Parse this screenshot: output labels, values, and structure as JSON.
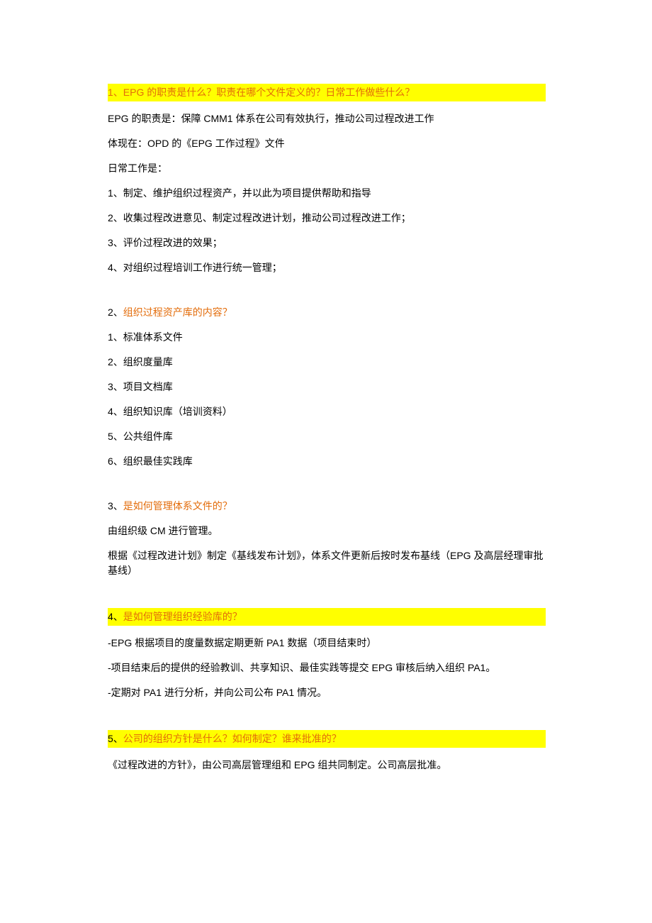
{
  "q1": {
    "heading": "1、EPG 的职责是什么？职责在哪个文件定义的？日常工作做些什么？",
    "p1": "EPG 的职责是：保障 CMM1 体系在公司有效执行，推动公司过程改进工作",
    "p2": "体现在：OPD 的《EPG 工作过程》文件",
    "p3": "日常工作是：",
    "i1": "1、制定、维护组织过程资产，并以此为项目提供帮助和指导",
    "i2": "2、收集过程改进意见、制定过程改进计划，推动公司过程改进工作；",
    "i3": "3、评价过程改进的效果；",
    "i4": "4、对组织过程培训工作进行统一管理；"
  },
  "q2": {
    "num": "2、",
    "title": "组织过程资产库的内容？",
    "i1": "1、标准体系文件",
    "i2": "2、组织度量库",
    "i3": "3、项目文档库",
    "i4": "4、组织知识库（培训资料）",
    "i5": "5、公共组件库",
    "i6": "6、组织最佳实践库"
  },
  "q3": {
    "num": "3、",
    "title": "是如何管理体系文件的？",
    "p1": "由组织级 CM 进行管理。",
    "p2": "根据《过程改进计划》制定《基线发布计划》，体系文件更新后按时发布基线（EPG 及高层经理审批基线）"
  },
  "q4": {
    "num": "4、",
    "title": "是如何管理组织经验库的？",
    "p1": "-EPG 根据项目的度量数据定期更新 PA1 数据（项目结束时）",
    "p2": "-项目结束后的提供的经验教训、共享知识、最佳实践等提交 EPG 审核后纳入组织 PA1。",
    "p3": "-定期对 PA1 进行分析，并向公司公布 PA1 情况。"
  },
  "q5": {
    "num": "5、",
    "title": "公司的组织方针是什么？如何制定？谁来批准的？",
    "p1": "《过程改进的方针》，由公司高层管理组和 EPG 组共同制定。公司高层批准。"
  }
}
